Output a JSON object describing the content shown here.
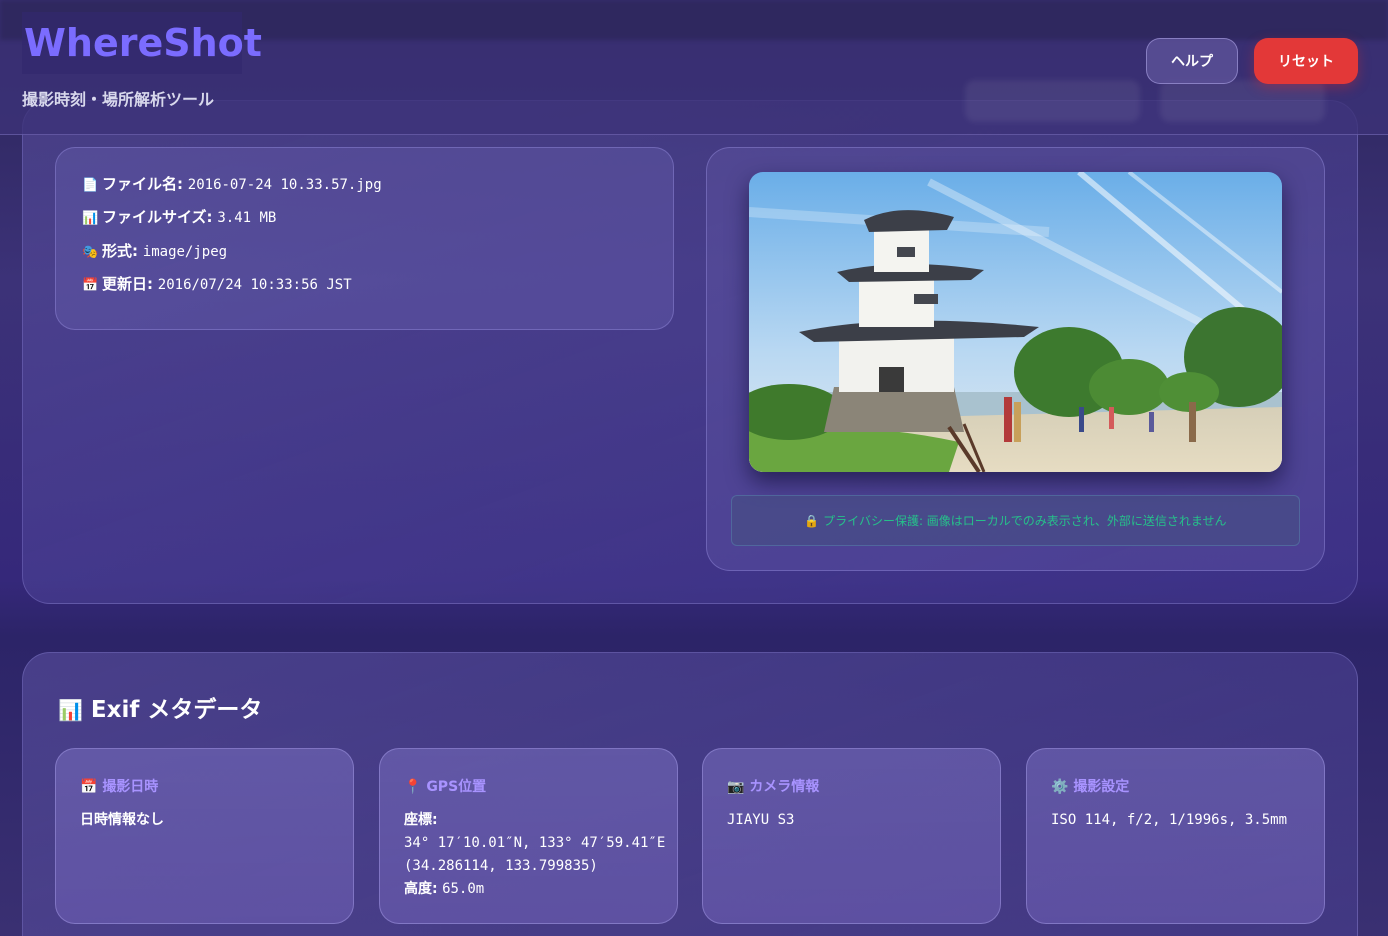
{
  "header": {
    "logo": "WhereShot",
    "subtitle": "撮影時刻・場所解析ツール",
    "help_button": "ヘルプ",
    "reset_button": "リセット"
  },
  "file_info": {
    "filename_label": "ファイル名:",
    "filename": "2016-07-24 10.33.57.jpg",
    "filesize_label": "ファイルサイズ:",
    "filesize": "3.41 MB",
    "format_label": "形式:",
    "format": "image/jpeg",
    "modified_label": "更新日:",
    "modified": "2016/07/24 10:33:56 JST"
  },
  "privacy_notice": "🔒 プライバシー保護: 画像はローカルでのみ表示され、外部に送信されません",
  "exif": {
    "title": "Exif メタデータ",
    "datetime": {
      "header": "撮影日時",
      "value": "日時情報なし"
    },
    "gps": {
      "header": "GPS位置",
      "coord_label": "座標:",
      "dms": "34° 17′10.01″N, 133° 47′59.41″E",
      "decimal": "(34.286114, 133.799835)",
      "altitude_label": "高度:",
      "altitude": "65.0m"
    },
    "camera": {
      "header": "カメラ情報",
      "value": "JIAYU S3"
    },
    "settings": {
      "header": "撮影設定",
      "value": "ISO 114, f/2, 1/1996s, 3.5mm"
    }
  },
  "colors": {
    "accent": "#7b6cff",
    "reset": "#e33838",
    "privacy_text": "#26c08a",
    "card_header": "#a893ff"
  }
}
